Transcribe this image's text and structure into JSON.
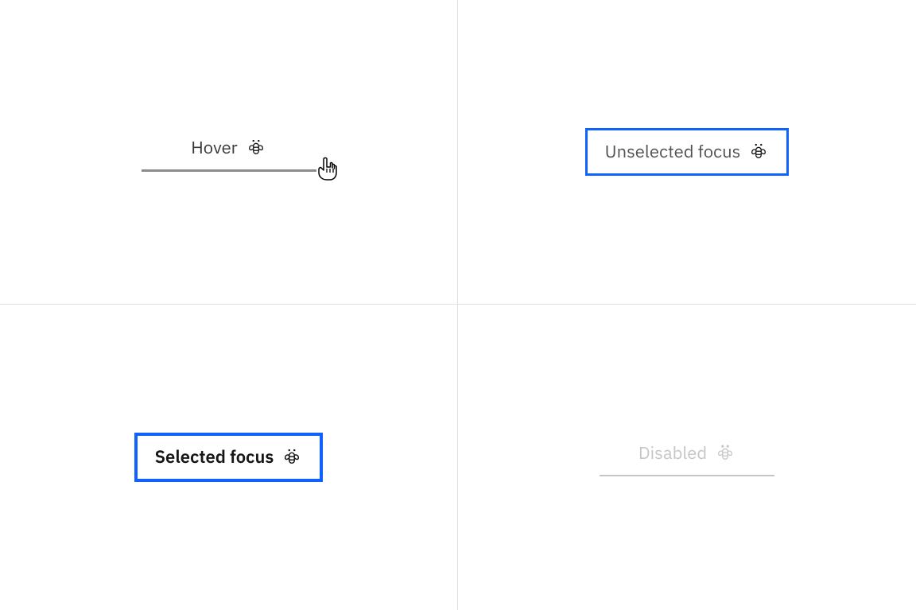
{
  "states": {
    "hover": {
      "label": "Hover"
    },
    "unselected_focus": {
      "label": "Unselected focus"
    },
    "selected_focus": {
      "label": "Selected focus"
    },
    "disabled": {
      "label": "Disabled"
    }
  },
  "colors": {
    "focus_ring": "#0f62fe",
    "hover_rule": "#8d8d8d",
    "disabled": "#c6c6c6",
    "text_primary": "#161616",
    "text_secondary": "#525252"
  },
  "icons": {
    "bee": "bee-icon",
    "cursor": "pointer-cursor-icon"
  }
}
